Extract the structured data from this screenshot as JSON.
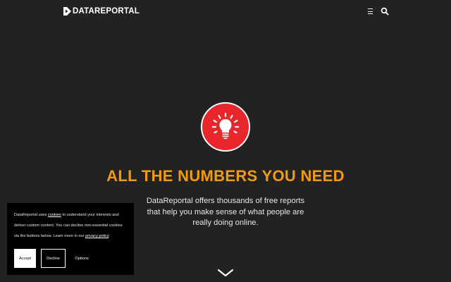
{
  "header": {
    "logo_text": "DATAREPORTAL",
    "menu_icon": "hamburger-menu-icon",
    "search_icon": "search-icon"
  },
  "hero": {
    "icon": "lightbulb-icon",
    "headline": "ALL THE NUMBERS YOU NEED",
    "subtext": "DataReportal offers thousands of free reports that help you make sense of what people are really doing online.",
    "scroll_icon": "chevron-down-icon"
  },
  "cookie_banner": {
    "text_before": "DataReportal uses ",
    "cookies_link": "cookies",
    "text_middle": " to understand your interests and deliver custom content. You can decline non-essential cookies via the buttons below. Learn more in our ",
    "privacy_link": "privacy policy",
    "text_after": ".",
    "accept_label": "Accept",
    "decline_label": "Decline",
    "options_label": "Options"
  },
  "colors": {
    "background": "#222222",
    "accent_orange": "#f29a12",
    "bulb_red": "#e8262b"
  }
}
